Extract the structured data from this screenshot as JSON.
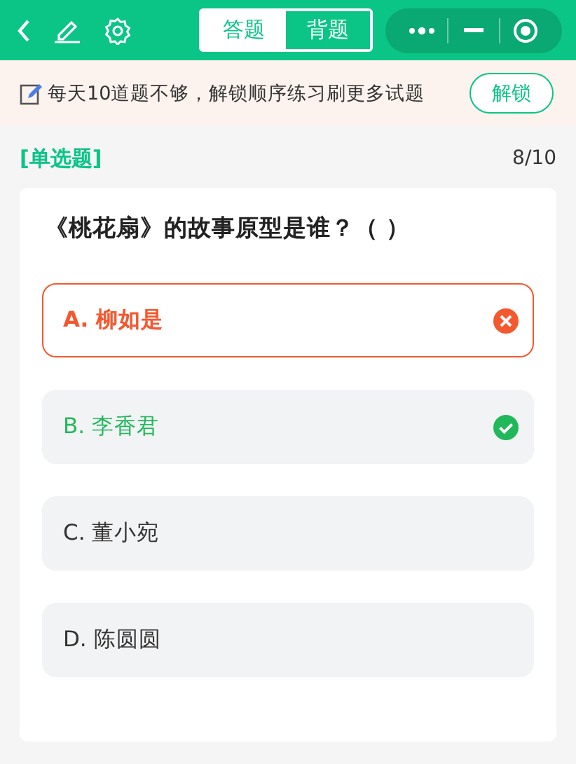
{
  "tabs": [
    {
      "label": "答题",
      "selected": false
    },
    {
      "label": "背题",
      "selected": true
    }
  ],
  "banner": {
    "text": "每天10道题不够，解锁顺序练习刷更多试题",
    "button": "解锁"
  },
  "question": {
    "type_label": "[单选题]",
    "progress": "8/10",
    "text": "《桃花扇》的故事原型是谁？（  ）"
  },
  "options": [
    {
      "text": "A. 柳如是",
      "chosen": true,
      "correct": false
    },
    {
      "text": "B. 李香君",
      "chosen": false,
      "correct": true
    },
    {
      "text": "C. 董小宛",
      "chosen": false,
      "correct": false
    },
    {
      "text": "D. 陈圆圆",
      "chosen": false,
      "correct": false
    }
  ]
}
